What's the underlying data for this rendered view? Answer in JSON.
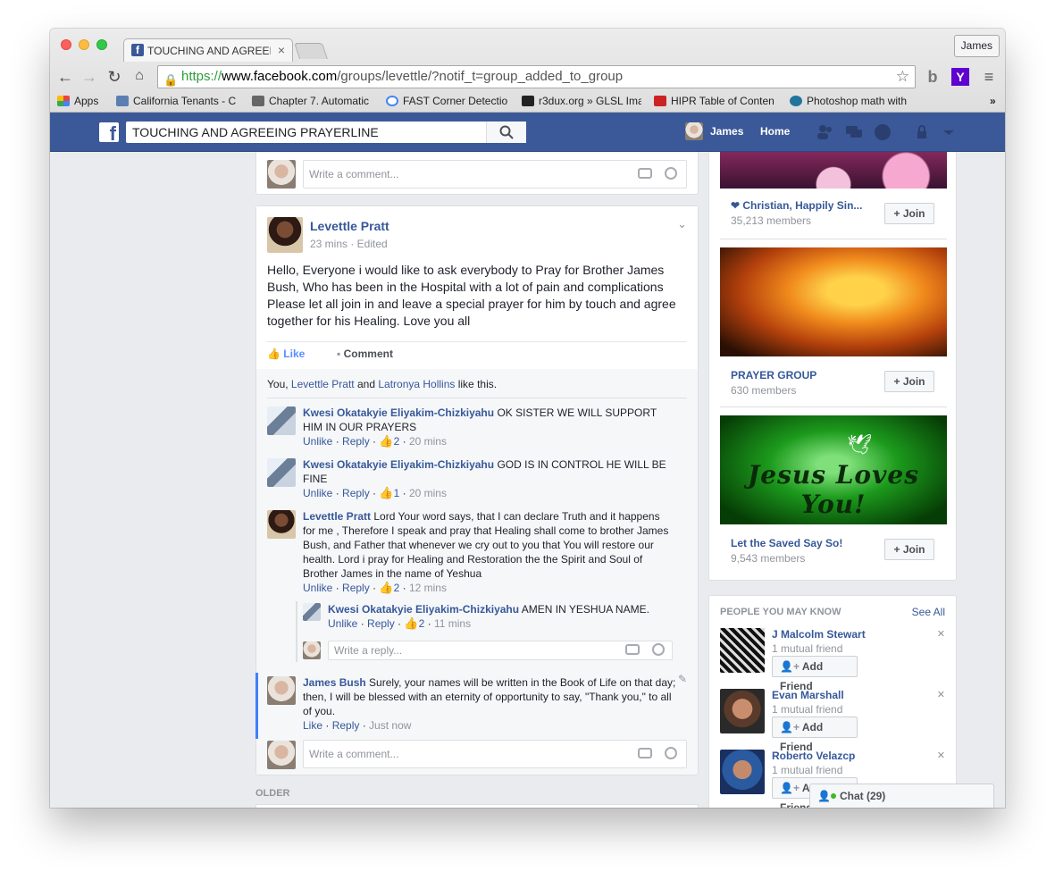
{
  "browser": {
    "tab_title": "TOUCHING AND AGREEING",
    "user_button": "James",
    "url_scheme": "https://",
    "url_host": "www.facebook.com",
    "url_path": "/groups/levettle/?notif_t=group_added_to_group",
    "bookmarks": [
      {
        "label": "Apps",
        "icon": "apps-grid-icon",
        "color": "#e8453c"
      },
      {
        "label": "California Tenants - C",
        "icon": "doc-icon",
        "color": "#5b7fb0"
      },
      {
        "label": "Chapter 7. Automatic",
        "icon": "doc-icon",
        "color": "#666666"
      },
      {
        "label": "FAST Corner Detectio",
        "icon": "google-icon",
        "color": "#4285f4"
      },
      {
        "label": "r3dux.org » GLSL Ima",
        "icon": "site-icon",
        "color": "#222222"
      },
      {
        "label": "HIPR Table of Conten",
        "icon": "site-icon",
        "color": "#cc2222"
      },
      {
        "label": "Photoshop math with",
        "icon": "wordpress-icon",
        "color": "#21759b"
      }
    ]
  },
  "facebook": {
    "search_value": "TOUCHING AND AGREEING PRAYERLINE",
    "user_name": "James",
    "home_label": "Home",
    "brand_color": "#3b5998"
  },
  "top_comment": {
    "placeholder": "Write a comment..."
  },
  "post": {
    "author": "Levettle Pratt",
    "meta": "23 mins · Edited",
    "text": "Hello, Everyone i would like to ask everybody to Pray for Brother James Bush, Who has been in the Hospital with a lot of pain and complications Please let all join in and leave a special prayer for him by touch and agree together for his Healing. Love you all",
    "like_label": "Like",
    "comment_label": "Comment",
    "likes": {
      "prefix": "You, ",
      "name1": "Levettle Pratt",
      "and": " and ",
      "name2": "Latronya Hollins",
      "suffix": " like this."
    },
    "comments": [
      {
        "author": "Kwesi Okatakyie Eliyakim-Chizkiyahu",
        "text": "OK SISTER WE WILL SUPPORT HIM IN OUR PRAYERS",
        "unlike": "Unlike",
        "reply": "Reply",
        "likes": "2",
        "time": "20 mins"
      },
      {
        "author": "Kwesi Okatakyie Eliyakim-Chizkiyahu",
        "text": "GOD IS IN CONTROL HE WILL BE FINE",
        "unlike": "Unlike",
        "reply": "Reply",
        "likes": "1",
        "time": "20 mins"
      },
      {
        "author": "Levettle Pratt",
        "text": "Lord Your word says, that I can declare Truth and it happens for me , Therefore I speak and pray that Healing shall come to brother James Bush, and Father that whenever we cry out to you that You will restore our health. Lord i pray for Healing and Restoration the the Spirit and Soul of Brother James in the name of Yeshua",
        "unlike": "Unlike",
        "reply": "Reply",
        "likes": "2",
        "time": "12 mins"
      }
    ],
    "reply": {
      "author": "Kwesi Okatakyie Eliyakim-Chizkiyahu",
      "text": "AMEN IN YESHUA NAME.",
      "unlike": "Unlike",
      "reply": "Reply",
      "likes": "2",
      "time": "11 mins"
    },
    "reply_placeholder": "Write a reply...",
    "my_comment": {
      "author": "James Bush",
      "text": "Surely, your names will be written in the Book of Life on that day; then, I will be blessed with an eternity of opportunity to say, \"Thank you,\" to all of you.",
      "like": "Like",
      "reply": "Reply",
      "time": "Just now"
    },
    "comment_placeholder": "Write a comment..."
  },
  "older_label": "OLDER",
  "groups": [
    {
      "name": "❤ Christian, Happily Sin...",
      "members": "35,213 members",
      "join": "+ Join"
    },
    {
      "name": "PRAYER GROUP",
      "members": "630 members",
      "join": "+ Join"
    },
    {
      "name": "Let the Saved Say So!",
      "members": "9,543 members",
      "join": "+ Join",
      "image_text": "Jesus Loves You!"
    }
  ],
  "people": {
    "title": "PEOPLE YOU MAY KNOW",
    "see_all": "See All",
    "items": [
      {
        "name": "J Malcolm Stewart",
        "mutual": "1 mutual friend",
        "button": "Add Friend"
      },
      {
        "name": "Evan Marshall",
        "mutual": "1 mutual friend",
        "button": "Add Friend"
      },
      {
        "name": "Roberto Velazcp",
        "mutual": "1 mutual friend",
        "button": "Add Friend"
      }
    ]
  },
  "chat": {
    "label": "Chat (29)"
  }
}
